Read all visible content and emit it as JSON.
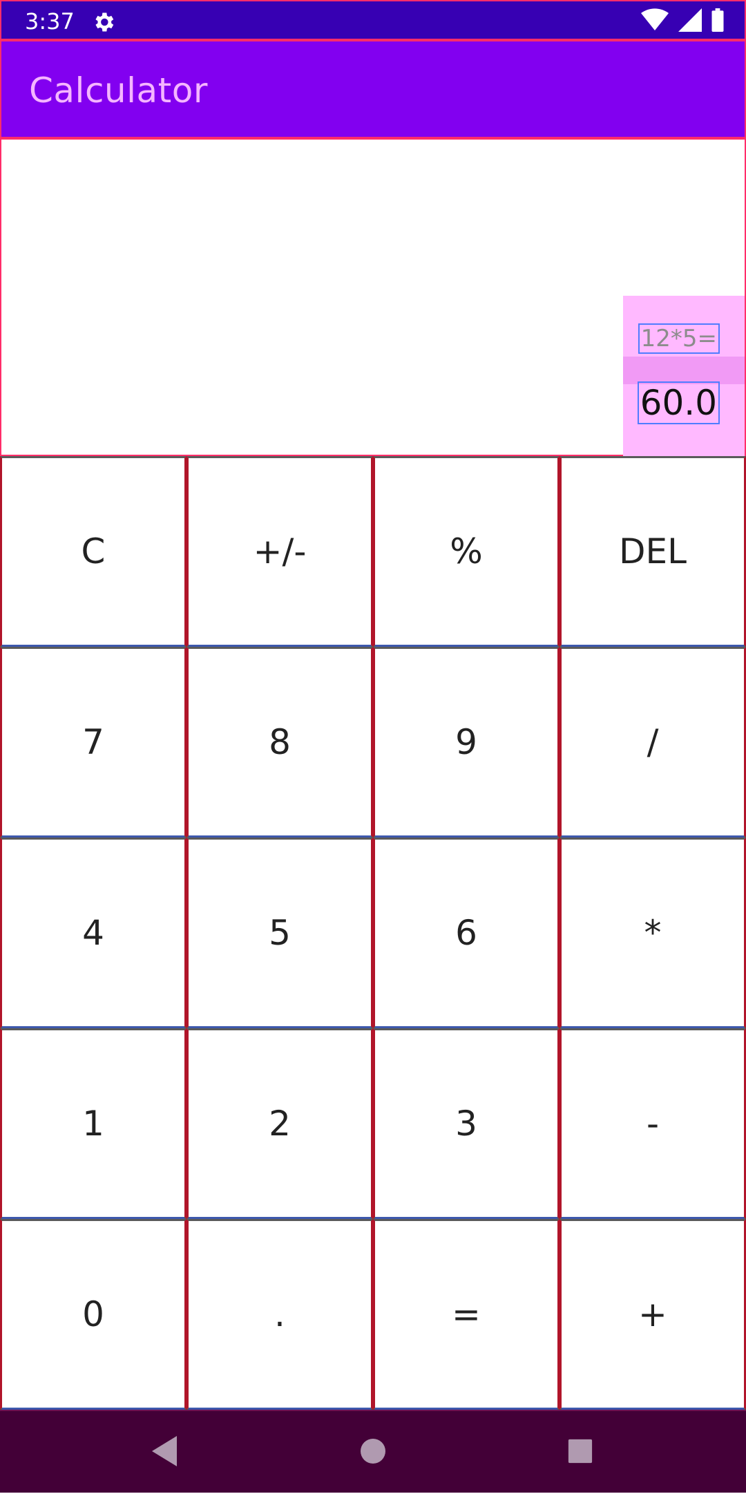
{
  "status_bar": {
    "time": "3:37",
    "icons": [
      "gear-icon",
      "wifi-icon",
      "signal-icon",
      "battery-icon"
    ]
  },
  "app_bar": {
    "title": "Calculator",
    "background": "#8200f0",
    "title_color": "#f5b5ff"
  },
  "display": {
    "expression": "12*5=",
    "result": "60.0"
  },
  "keypad": {
    "rows": [
      [
        "C",
        "+/-",
        "%",
        "DEL"
      ],
      [
        "7",
        "8",
        "9",
        "/"
      ],
      [
        "4",
        "5",
        "6",
        "*"
      ],
      [
        "1",
        "2",
        "3",
        "-"
      ],
      [
        "0",
        ".",
        "=",
        "+"
      ]
    ]
  },
  "nav_bar": {
    "buttons": [
      "back-icon",
      "home-icon",
      "recents-icon"
    ]
  }
}
